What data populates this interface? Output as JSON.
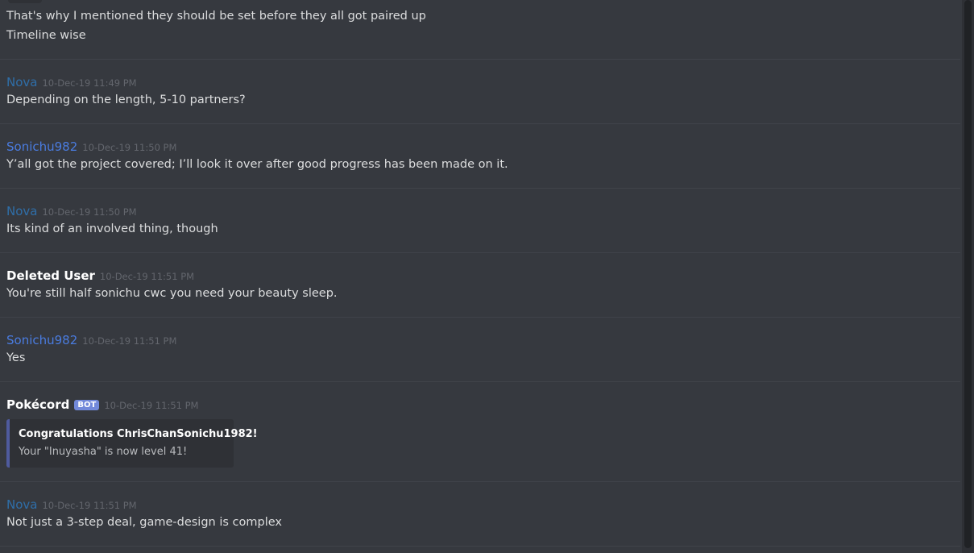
{
  "messages": [
    {
      "continuation": true,
      "lines": [
        "That's why I mentioned they should be set before they all got paired up",
        "Timeline wise"
      ]
    },
    {
      "author": "Nova",
      "timestamp": "10-Dec-19 11:49 PM",
      "lines": [
        "Depending on the length, 5-10 partners?"
      ]
    },
    {
      "author": "Sonichu982",
      "timestamp": "10-Dec-19 11:50 PM",
      "lines": [
        "Y’all got the project covered; I’ll look it over after good progress has been made on it."
      ]
    },
    {
      "author": "Nova",
      "timestamp": "10-Dec-19 11:50 PM",
      "lines": [
        "Its kind of an involved thing, though"
      ]
    },
    {
      "author": "Deleted User",
      "timestamp": "10-Dec-19 11:51 PM",
      "lines": [
        "You're still half sonichu cwc you need your beauty sleep."
      ]
    },
    {
      "author": "Sonichu982",
      "timestamp": "10-Dec-19 11:51 PM",
      "lines": [
        "Yes"
      ]
    },
    {
      "author": "Pokécord",
      "bot_tag": "BOT",
      "timestamp": "10-Dec-19 11:51 PM",
      "embed": {
        "title": "Congratulations ChrisChanSonichu1982!",
        "description": "Your \"Inuyasha\" is now level 41!"
      }
    },
    {
      "author": "Nova",
      "timestamp": "10-Dec-19 11:51 PM",
      "lines": [
        "Not just a 3-step deal, game-design is complex"
      ]
    }
  ],
  "colors": {
    "background": "#36393f",
    "nova": "#2f6ea8",
    "sonichu": "#4a7ce0",
    "deleted_user": "#ffffff",
    "bot_tag": "#7289da"
  }
}
